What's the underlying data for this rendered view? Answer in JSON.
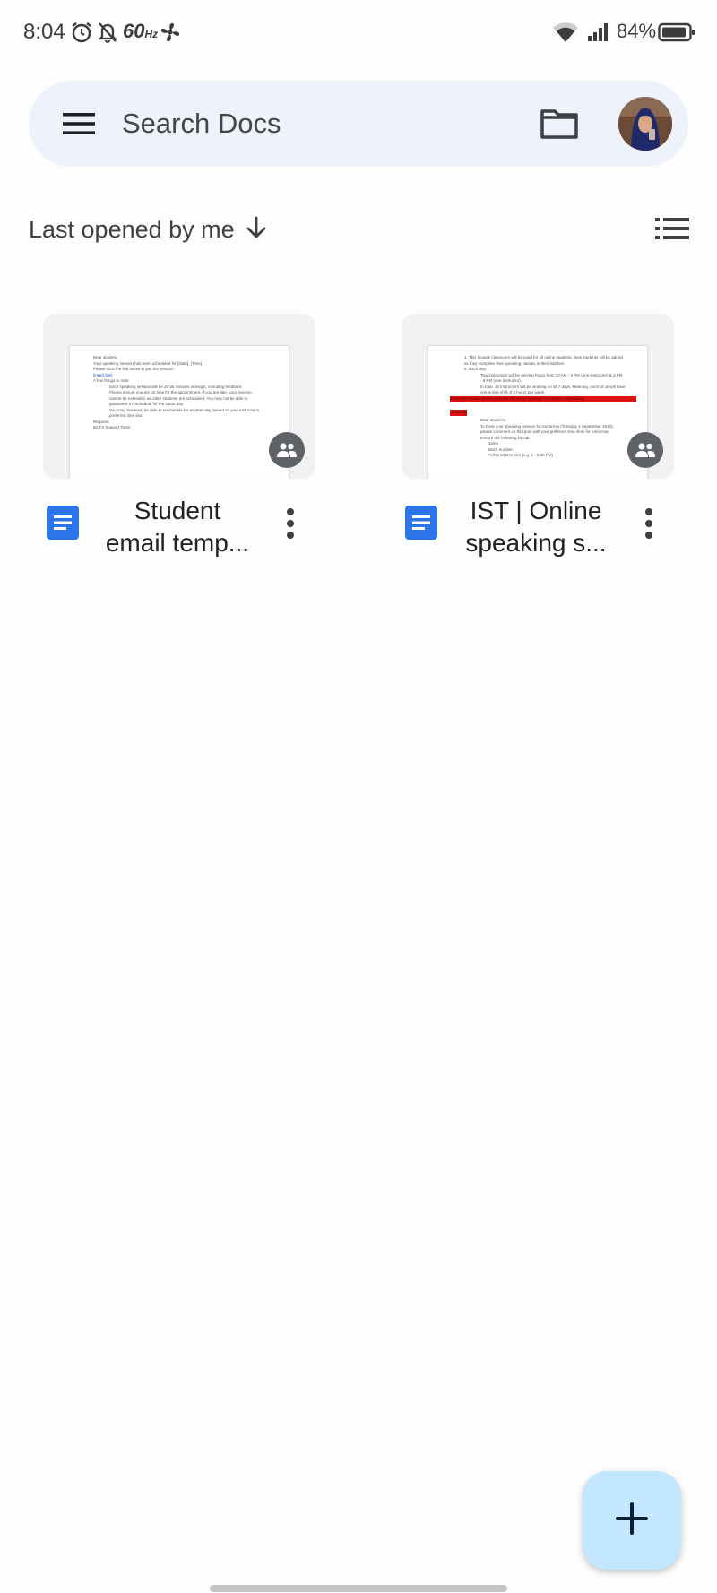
{
  "status_bar": {
    "time": "8:04",
    "refresh_rate": "60",
    "refresh_unit": "Hz",
    "battery": "84%",
    "icons": [
      "alarm-icon",
      "bell-off-icon",
      "fan-icon",
      "wifi-icon",
      "signal-icon",
      "battery-icon"
    ]
  },
  "search": {
    "placeholder": "Search Docs",
    "menu_icon": "menu-icon",
    "folder_icon": "folder-icon"
  },
  "sort": {
    "label": "Last opened by me",
    "direction_icon": "arrow-down-icon",
    "view_icon": "list-view-icon"
  },
  "documents": [
    {
      "title_line1": "Student",
      "title_line2": "email temp...",
      "shared": true,
      "preview_lines": [
        "Dear student,",
        "Your speaking session has been scheduled for [Date], [Time]",
        "Please click the link below to join the session:",
        "[insert link]",
        "A few things to note:",
        "Each speaking session will be 20-25 minutes in length, including feedback.",
        "Please ensure you are on time for the appointment. If you are late, your session",
        "cannot be extended, as other students are scheduled. You may not be able to",
        "guarantee a reschedule for the same day.",
        "You may, however, be able to reschedule for another day, based on your instructor's",
        "preferred time slot.",
        "Regards,",
        "IELTS Support Team."
      ]
    },
    {
      "title_line1": "IST | Online",
      "title_line2": "speaking s...",
      "shared": true,
      "preview_lines": [
        "1. This Google classroom will be used for all online students. New students will be added",
        "as they complete their speaking classes in their batches.",
        "2. Each day:",
        "Two instructors will be serving hours from 10 AM - 3 PM (one instructor) & 3 PM",
        "- 8 PM (one instructor).",
        "In total, 14 instructors will be working on all 7 days. Meaning, each of us will have",
        "one online shift of 5 hours per week.",
        "Everyone should please post the following message for session scheduling:",
        "(Morning)",
        "Dear students,",
        "To book your speaking session for tomorrow (Tuesday 1 September 2020),",
        "please comment on this post with your preferred time slots for tomorrow.",
        "Ensure the following format:",
        "Name",
        "Batch number",
        "Preferred time slot (e.g. 5 - 5:30 PM)"
      ]
    }
  ],
  "fab": {
    "icon": "plus-icon"
  }
}
